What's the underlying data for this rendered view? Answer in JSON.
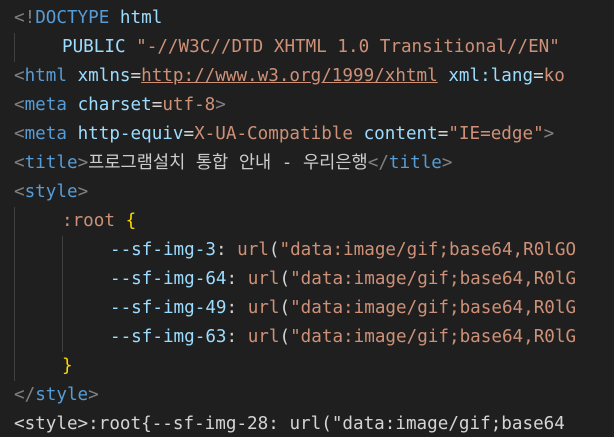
{
  "editor": {
    "lines": [
      {
        "indent": 0,
        "tokens": [
          {
            "t": "<!",
            "c": "punc"
          },
          {
            "t": "DOCTYPE",
            "c": "tag"
          },
          {
            "t": " html",
            "c": "attr"
          }
        ]
      },
      {
        "indent": 1,
        "tokens": [
          {
            "t": "PUBLIC",
            "c": "attr"
          },
          {
            "t": " ",
            "c": "txt"
          },
          {
            "t": "\"-//W3C//DTD XHTML 1.0 Transitional//EN\"",
            "c": "str"
          }
        ]
      },
      {
        "indent": 0,
        "tokens": [
          {
            "t": "<",
            "c": "punc"
          },
          {
            "t": "html",
            "c": "tag"
          },
          {
            "t": " ",
            "c": "txt"
          },
          {
            "t": "xmlns",
            "c": "attr"
          },
          {
            "t": "=",
            "c": "white"
          },
          {
            "t": "http://www.w3.org/1999/xhtml",
            "c": "str link"
          },
          {
            "t": " ",
            "c": "txt"
          },
          {
            "t": "xml:lang",
            "c": "attr"
          },
          {
            "t": "=",
            "c": "white"
          },
          {
            "t": "ko",
            "c": "str"
          }
        ]
      },
      {
        "indent": 0,
        "tokens": [
          {
            "t": "<",
            "c": "punc"
          },
          {
            "t": "meta",
            "c": "tag"
          },
          {
            "t": " ",
            "c": "txt"
          },
          {
            "t": "charset",
            "c": "attr"
          },
          {
            "t": "=",
            "c": "white"
          },
          {
            "t": "utf-8",
            "c": "str"
          },
          {
            "t": ">",
            "c": "punc"
          }
        ]
      },
      {
        "indent": 0,
        "tokens": [
          {
            "t": "<",
            "c": "punc"
          },
          {
            "t": "meta",
            "c": "tag"
          },
          {
            "t": " ",
            "c": "txt"
          },
          {
            "t": "http-equiv",
            "c": "attr"
          },
          {
            "t": "=",
            "c": "white"
          },
          {
            "t": "X-UA-Compatible",
            "c": "str"
          },
          {
            "t": " ",
            "c": "txt"
          },
          {
            "t": "content",
            "c": "attr"
          },
          {
            "t": "=",
            "c": "white"
          },
          {
            "t": "\"IE=edge\"",
            "c": "str"
          },
          {
            "t": ">",
            "c": "punc"
          }
        ]
      },
      {
        "indent": 0,
        "tokens": [
          {
            "t": "<",
            "c": "punc"
          },
          {
            "t": "title",
            "c": "tag"
          },
          {
            "t": ">",
            "c": "punc"
          },
          {
            "t": "프로그램설치 통합 안내 - 우리은행",
            "c": "txt"
          },
          {
            "t": "</",
            "c": "punc"
          },
          {
            "t": "title",
            "c": "tag"
          },
          {
            "t": ">",
            "c": "punc"
          }
        ]
      },
      {
        "indent": 0,
        "tokens": [
          {
            "t": "<",
            "c": "punc"
          },
          {
            "t": "style",
            "c": "tag"
          },
          {
            "t": ">",
            "c": "punc"
          }
        ]
      },
      {
        "indent": 1,
        "tokens": [
          {
            "t": ":root",
            "c": "str"
          },
          {
            "t": " ",
            "c": "txt"
          },
          {
            "t": "{",
            "c": "brace"
          }
        ]
      },
      {
        "indent": 2,
        "tokens": [
          {
            "t": "--sf-img-3",
            "c": "attr"
          },
          {
            "t": ": ",
            "c": "white"
          },
          {
            "t": "url",
            "c": "str"
          },
          {
            "t": "(",
            "c": "white"
          },
          {
            "t": "\"data:image/gif;base64,R0lGO",
            "c": "str"
          }
        ]
      },
      {
        "indent": 2,
        "tokens": [
          {
            "t": "--sf-img-64",
            "c": "attr"
          },
          {
            "t": ": ",
            "c": "white"
          },
          {
            "t": "url",
            "c": "str"
          },
          {
            "t": "(",
            "c": "white"
          },
          {
            "t": "\"data:image/gif;base64,R0lG",
            "c": "str"
          }
        ]
      },
      {
        "indent": 2,
        "tokens": [
          {
            "t": "--sf-img-49",
            "c": "attr"
          },
          {
            "t": ": ",
            "c": "white"
          },
          {
            "t": "url",
            "c": "str"
          },
          {
            "t": "(",
            "c": "white"
          },
          {
            "t": "\"data:image/gif;base64,R0lG",
            "c": "str"
          }
        ]
      },
      {
        "indent": 2,
        "tokens": [
          {
            "t": "--sf-img-63",
            "c": "attr"
          },
          {
            "t": ": ",
            "c": "white"
          },
          {
            "t": "url",
            "c": "str"
          },
          {
            "t": "(",
            "c": "white"
          },
          {
            "t": "\"data:image/gif;base64,R0lG",
            "c": "str"
          }
        ]
      },
      {
        "indent": 1,
        "tokens": [
          {
            "t": "}",
            "c": "brace"
          }
        ]
      },
      {
        "indent": 0,
        "tokens": [
          {
            "t": "</",
            "c": "punc"
          },
          {
            "t": "style",
            "c": "tag"
          },
          {
            "t": ">",
            "c": "punc"
          }
        ]
      },
      {
        "indent": 0,
        "tokens": [
          {
            "t": "<style>",
            "c": "white"
          },
          {
            "t": ":root{",
            "c": "white"
          },
          {
            "t": "--sf-img-28",
            "c": "white"
          },
          {
            "t": ": ",
            "c": "white"
          },
          {
            "t": "url(",
            "c": "white"
          },
          {
            "t": "\"data:image/gif;base64",
            "c": "white"
          }
        ]
      }
    ]
  }
}
